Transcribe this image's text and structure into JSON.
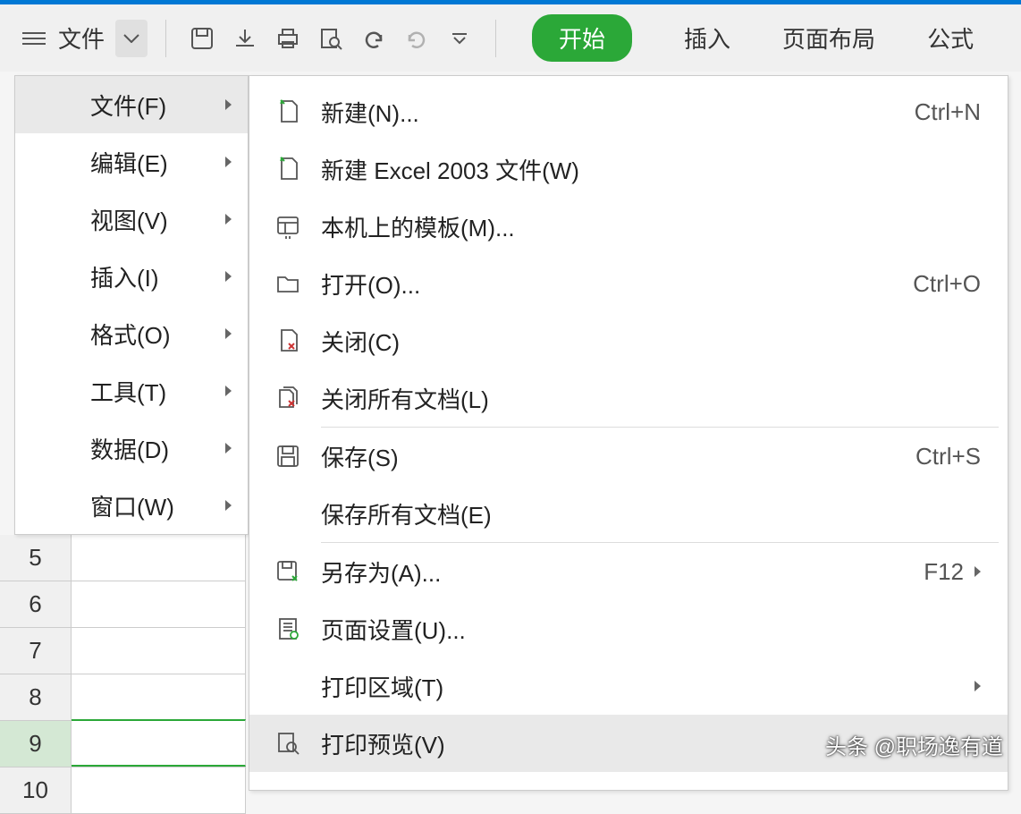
{
  "toolbar": {
    "file_label": "文件",
    "start_label": "开始",
    "tabs": [
      "插入",
      "页面布局",
      "公式"
    ]
  },
  "main_menu": [
    {
      "label": "文件(F)",
      "active": true
    },
    {
      "label": "编辑(E)",
      "active": false
    },
    {
      "label": "视图(V)",
      "active": false
    },
    {
      "label": "插入(I)",
      "active": false
    },
    {
      "label": "格式(O)",
      "active": false
    },
    {
      "label": "工具(T)",
      "active": false
    },
    {
      "label": "数据(D)",
      "active": false
    },
    {
      "label": "窗口(W)",
      "active": false
    }
  ],
  "sub_menu": [
    {
      "icon": "new",
      "label": "新建(N)...",
      "shortcut": "Ctrl+N"
    },
    {
      "icon": "new",
      "label": "新建 Excel 2003 文件(W)",
      "shortcut": ""
    },
    {
      "icon": "template",
      "label": "本机上的模板(M)...",
      "shortcut": ""
    },
    {
      "icon": "folder",
      "label": "打开(O)...",
      "shortcut": "Ctrl+O"
    },
    {
      "icon": "close",
      "label": "关闭(C)",
      "shortcut": ""
    },
    {
      "icon": "closeall",
      "label": "关闭所有文档(L)",
      "shortcut": "",
      "divider": true
    },
    {
      "icon": "save",
      "label": "保存(S)",
      "shortcut": "Ctrl+S"
    },
    {
      "icon": "",
      "label": "保存所有文档(E)",
      "shortcut": "",
      "divider": true
    },
    {
      "icon": "saveas",
      "label": "另存为(A)...",
      "shortcut": "F12",
      "arrow": true
    },
    {
      "icon": "pagesetup",
      "label": "页面设置(U)...",
      "shortcut": ""
    },
    {
      "icon": "",
      "label": "打印区域(T)",
      "shortcut": "",
      "arrow": true
    },
    {
      "icon": "printpreview",
      "label": "打印预览(V)",
      "shortcut": "",
      "hovered": true
    }
  ],
  "rows": [
    "5",
    "6",
    "7",
    "8",
    "9",
    "10"
  ],
  "active_row": "9",
  "watermark": "头条 @职场逸有道"
}
